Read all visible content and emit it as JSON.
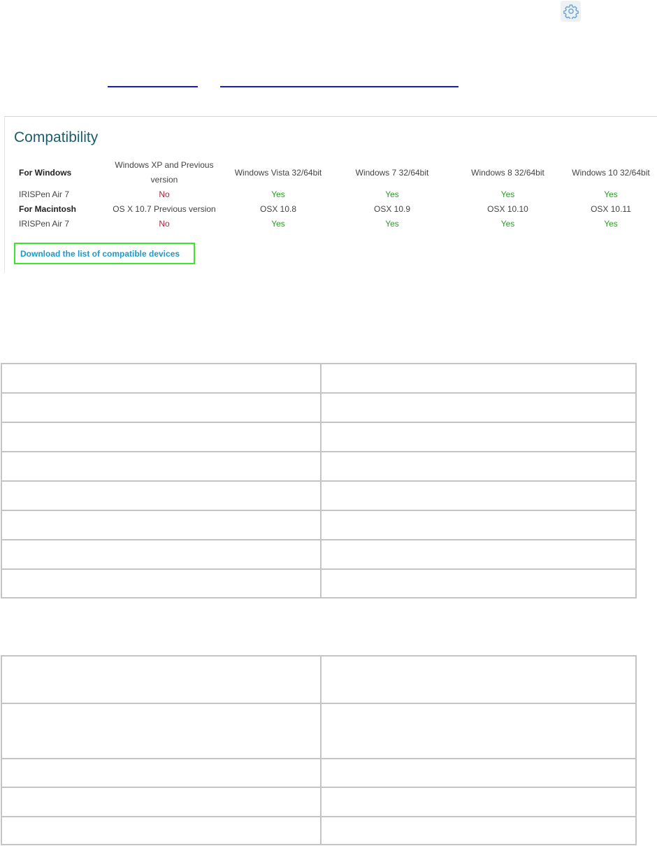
{
  "toolbar": {
    "settings_icon": "gear-icon",
    "accent_color": "#6ba6d6"
  },
  "links": [
    {
      "label": ""
    },
    {
      "label": ""
    }
  ],
  "compatibility": {
    "title": "Compatibility",
    "title_color": "#1f5c69",
    "windows": {
      "header": "For Windows",
      "columns": [
        "Windows XP and Previous version",
        "Windows Vista 32/64bit",
        "Windows 7 32/64bit",
        "Windows 8 32/64bit",
        "Windows 10 32/64bit"
      ],
      "product": "IRISPen Air 7",
      "values": [
        "No",
        "Yes",
        "Yes",
        "Yes",
        "Yes"
      ]
    },
    "mac": {
      "header": "For Macintosh",
      "columns": [
        "OS X 10.7 Previous version",
        "OSX 10.8",
        "OSX 10.9",
        "OSX 10.10",
        "OSX 10.11"
      ],
      "product": "IRISPen Air 7",
      "values": [
        "No",
        "Yes",
        "Yes",
        "Yes",
        "Yes"
      ]
    },
    "download_label": "Download the list of compatible devices",
    "colors": {
      "no": "#a8253a",
      "yes": "#2e9a2a",
      "link": "#1b9ac7",
      "highlight": "#3de62e"
    }
  },
  "spec_table_1": {
    "rows": [
      [
        "",
        ""
      ],
      [
        "",
        ""
      ],
      [
        "",
        ""
      ],
      [
        "",
        ""
      ],
      [
        "",
        ""
      ],
      [
        "",
        ""
      ],
      [
        "",
        ""
      ],
      [
        "",
        ""
      ]
    ]
  },
  "spec_table_2": {
    "rows": [
      [
        "",
        ""
      ],
      [
        "",
        ""
      ],
      [
        "",
        ""
      ],
      [
        "",
        ""
      ],
      [
        "",
        ""
      ]
    ]
  }
}
